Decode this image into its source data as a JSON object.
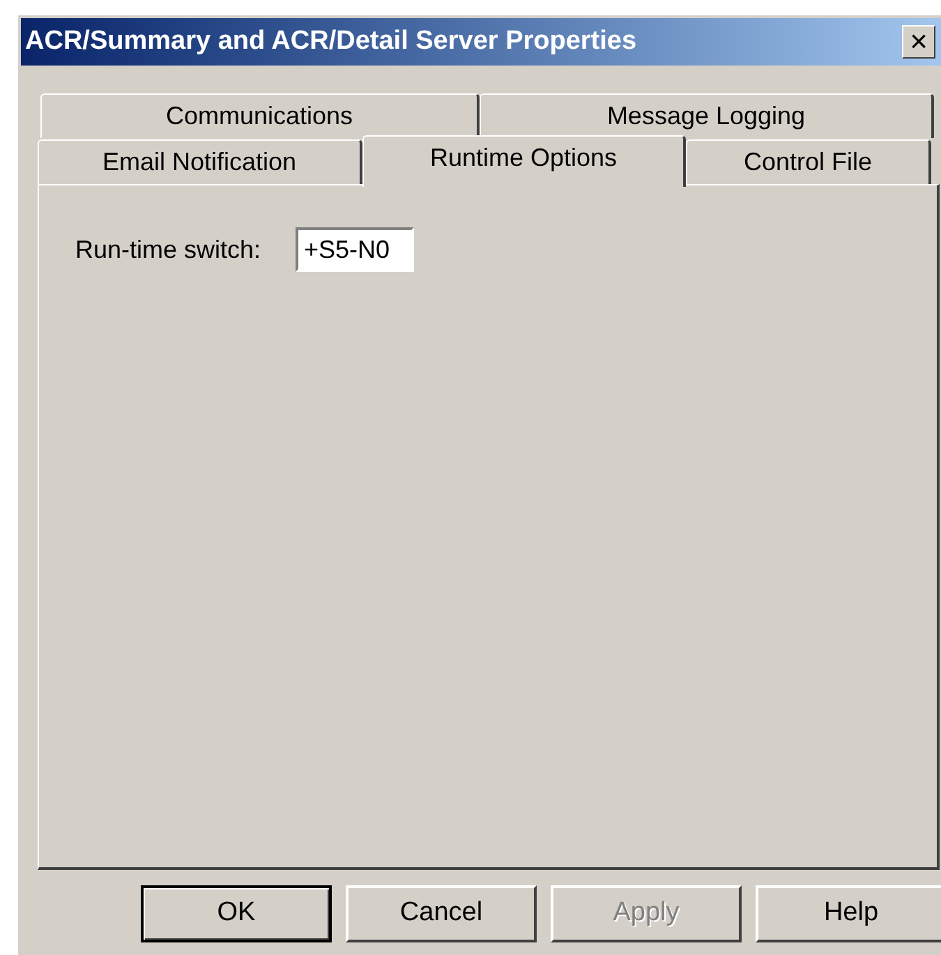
{
  "window": {
    "title": "ACR/Summary and ACR/Detail Server Properties",
    "close": "×"
  },
  "tab_rows": [
    {
      "tabs": [
        {
          "label": "Communications",
          "selected": false
        },
        {
          "label": "Message Logging",
          "selected": false
        }
      ]
    },
    {
      "tabs": [
        {
          "label": "Email Notification",
          "selected": false
        },
        {
          "label": "Runtime Options",
          "selected": true
        },
        {
          "label": "Control File",
          "selected": false
        }
      ]
    }
  ],
  "field": {
    "label": "Run-time switch:",
    "value": "+S5-N0"
  },
  "buttons": [
    {
      "label": "OK",
      "default": true,
      "disabled": false
    },
    {
      "label": "Cancel",
      "default": false,
      "disabled": false
    },
    {
      "label": "Apply",
      "default": false,
      "disabled": true
    },
    {
      "label": "Help",
      "default": false,
      "disabled": false
    }
  ]
}
